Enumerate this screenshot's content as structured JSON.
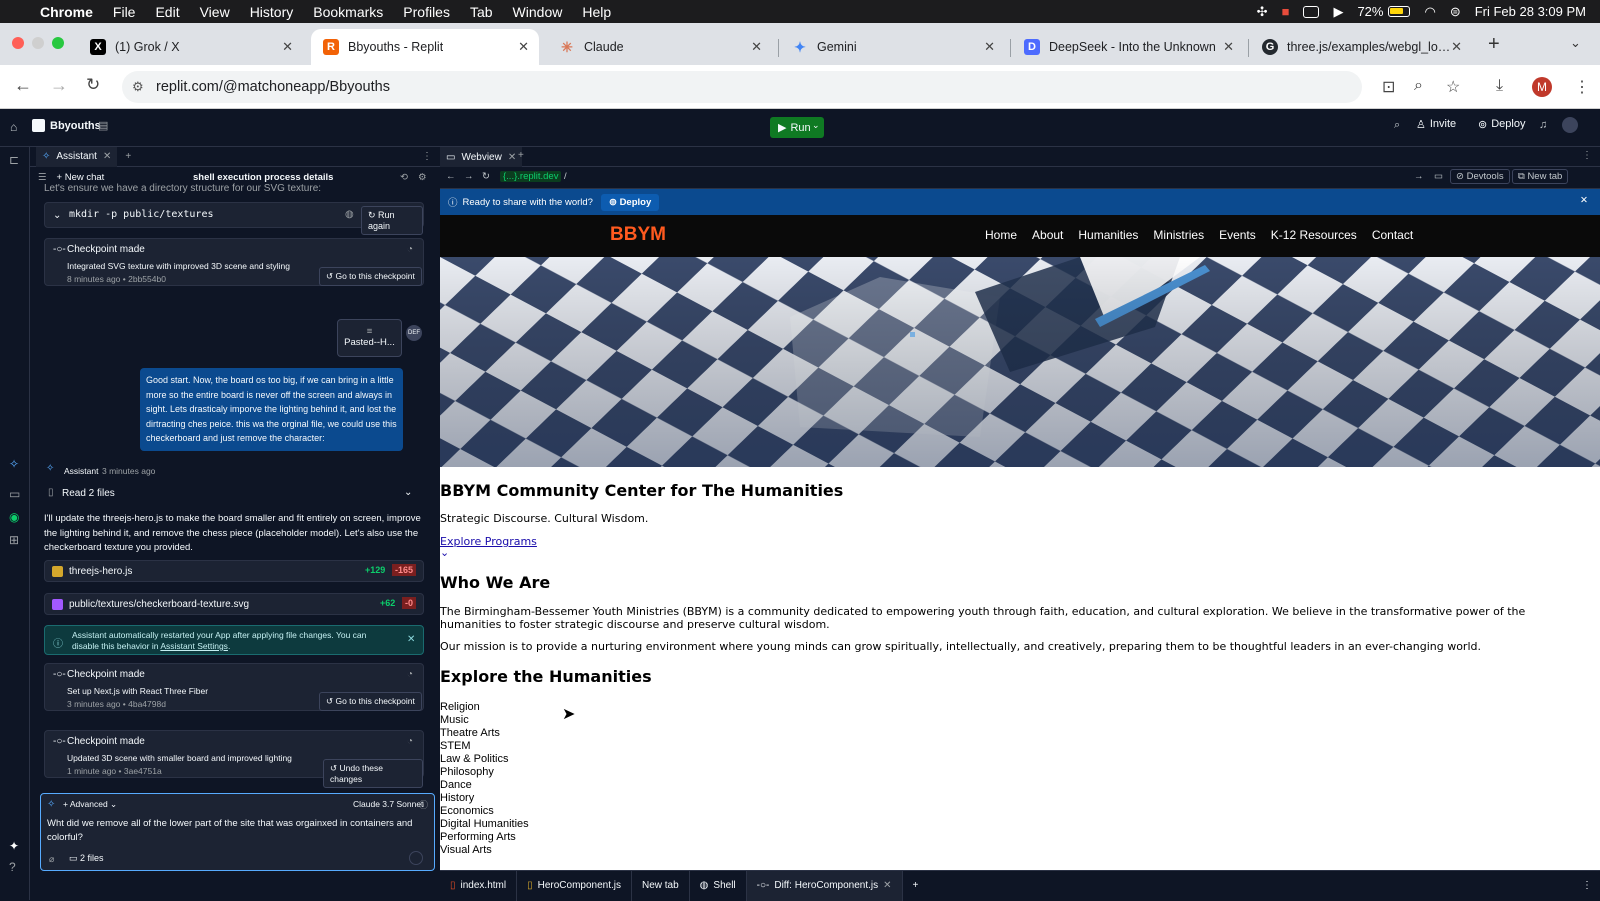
{
  "menubar": {
    "app": "Chrome",
    "items": [
      "File",
      "Edit",
      "View",
      "History",
      "Bookmarks",
      "Profiles",
      "Tab",
      "Window",
      "Help"
    ],
    "battery": "72%",
    "datetime": "Fri Feb 28  3:09 PM"
  },
  "tabs": [
    {
      "title": "(1) Grok / X",
      "icon": "x-logo-icon",
      "color": "#000000",
      "glyph": "X"
    },
    {
      "title": "Bbyouths - Replit",
      "icon": "replit-logo-icon",
      "color": "#f26207",
      "glyph": "R"
    },
    {
      "title": "Claude",
      "icon": "claude-logo-icon",
      "color": "#d97757",
      "glyph": "✳"
    },
    {
      "title": "Gemini",
      "icon": "gemini-logo-icon",
      "color": "#4285f4",
      "glyph": "✦"
    },
    {
      "title": "DeepSeek - Into the Unknown",
      "icon": "deepseek-logo-icon",
      "color": "#4d6bfe",
      "glyph": "D"
    },
    {
      "title": "three.js/examples/webgl_loade",
      "icon": "github-logo-icon",
      "color": "#24292f",
      "glyph": "G"
    }
  ],
  "address": {
    "url": "replit.com/@matchoneapp/Bbyouths",
    "avatar": "M"
  },
  "replit": {
    "project": "Bbyouths",
    "run": "Run",
    "invite": "Invite",
    "deploy": "Deploy"
  },
  "assistant": {
    "tab": "Assistant",
    "new_chat": "New chat",
    "thread_title": "shell execution process details",
    "intro_line": "Let's ensure we have a directory structure for our SVG texture:",
    "command": "mkdir -p public/textures",
    "run_again": "Run again",
    "checkpoint1": {
      "title": "Checkpoint made",
      "desc": "Integrated SVG texture with improved 3D scene and styling",
      "meta": "8 minutes ago",
      "hash": "2bb554b0",
      "button": "Go to this checkpoint"
    },
    "pasted": "Pasted--H...",
    "user_msg": "Good start. Now, the board os too big, if we can bring in a little more so the entire board is never off the screen and always in sight. Lets drasticaly imporve the lighting behind it, and lost the dirtracting ches peice. this wa the orginal file, we could use this checkerboard and just remove the character:",
    "assistant_label": "Assistant",
    "assistant_time": "3 minutes ago",
    "read_files": "Read 2 files",
    "reply": "I'll update the threejs-hero.js to make the board smaller and fit entirely on screen, improve the lighting behind it, and remove the chess piece (placeholder model). Let's also use the checkerboard texture you provided.",
    "file1": {
      "name": "threejs-hero.js",
      "add": "+129",
      "del": "-165"
    },
    "file2": {
      "name": "public/textures/checkerboard-texture.svg",
      "add": "+62",
      "del": "-0"
    },
    "notice": "Assistant automatically restarted your App after applying file changes. You can disable this behavior in ",
    "notice_link": "Assistant Settings",
    "notice_end": ".",
    "checkpoint2": {
      "title": "Checkpoint made",
      "desc": "Set up Next.js with React Three Fiber",
      "meta": "3 minutes ago",
      "hash": "4ba4798d",
      "button": "Go to this checkpoint"
    },
    "checkpoint3": {
      "title": "Checkpoint made",
      "desc": "Updated 3D scene with smaller board and improved lighting",
      "meta": "1 minute ago",
      "hash": "3ae4751a",
      "button": "Undo these changes"
    },
    "composer": {
      "mode": "Advanced",
      "model": "Claude 3.7 Sonnet",
      "text": "Wht did we remove all of the lower part of the site that was orgainxed in containers and colorful?",
      "files": "2 files"
    }
  },
  "webview": {
    "tab": "Webview",
    "url_host": "{...}.replit.dev",
    "url_path": "/",
    "devtools": "Devtools",
    "new_tab": "New tab",
    "deploy_prompt": "Ready to share with the world?",
    "deploy_btn": "Deploy"
  },
  "site": {
    "logo": "BBYM",
    "nav": [
      "Home",
      "About",
      "Humanities",
      "Ministries",
      "Events",
      "K-12 Resources",
      "Contact"
    ],
    "h1": "BBYM Community Center for The Humanities",
    "tagline": "Strategic Discourse. Cultural Wisdom.",
    "cta": "Explore Programs",
    "who_title": "Who We Are",
    "who_p1": "The Birmingham-Bessemer Youth Ministries (BBYM) is a community dedicated to empowering youth through faith, education, and cultural exploration. We believe in the transformative power of the humanities to foster strategic discourse and preserve cultural wisdom.",
    "who_p2": "Our mission is to provide a nurturing environment where young minds can grow spiritually, intellectually, and creatively, preparing them to be thoughtful leaders in an ever-changing world.",
    "explore_title": "Explore the Humanities",
    "list": [
      "Religion",
      "Music",
      "Theatre Arts",
      "STEM",
      "Law & Politics",
      "Philosophy",
      "Dance",
      "History",
      "Economics",
      "Digital Humanities",
      "Performing Arts",
      "Visual Arts"
    ]
  },
  "bottom_tabs": [
    "index.html",
    "HeroComponent.js",
    "New tab",
    "Shell",
    "Diff: HeroComponent.js"
  ]
}
